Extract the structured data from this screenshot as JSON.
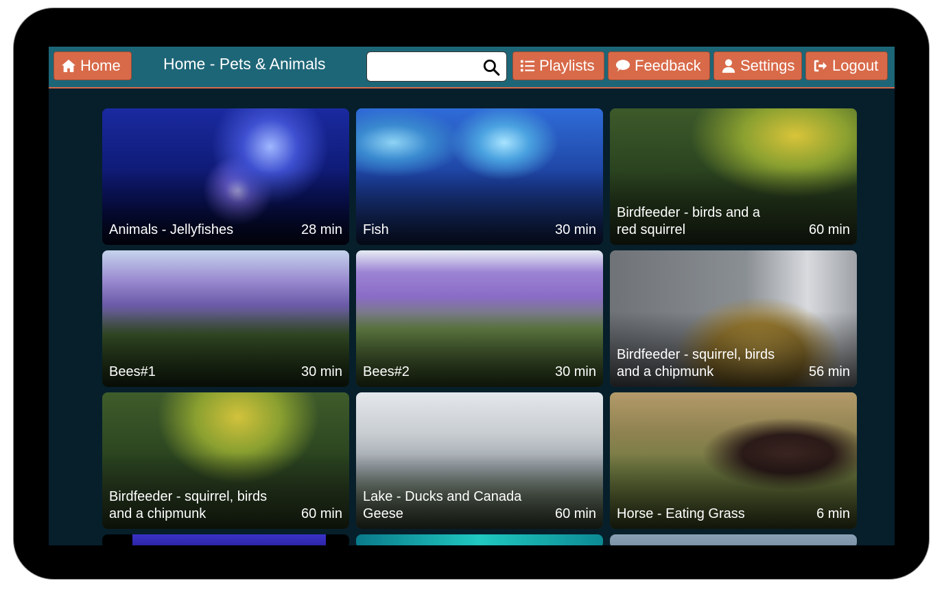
{
  "nav": {
    "home_label": "Home",
    "page_title": "Home - Pets & Animals",
    "search": {
      "value": "",
      "placeholder": ""
    },
    "playlists_label": "Playlists",
    "feedback_label": "Feedback",
    "settings_label": "Settings",
    "logout_label": "Logout"
  },
  "colors": {
    "topbar": "#1d6677",
    "button": "#d86a49",
    "background": "#061f2b"
  },
  "videos": [
    {
      "title": "Animals - Jellyfishes",
      "duration": "28 min",
      "thumbnail": "jellyfish"
    },
    {
      "title": "Fish",
      "duration": "30 min",
      "thumbnail": "aquarium-fish"
    },
    {
      "title": "Birdfeeder - birds and a red squirrel",
      "duration": "60 min",
      "thumbnail": "garden-birdfeeder"
    },
    {
      "title": "Bees#1",
      "duration": "30 min",
      "thumbnail": "lavender-field"
    },
    {
      "title": "Bees#2",
      "duration": "30 min",
      "thumbnail": "lavender-field"
    },
    {
      "title": "Birdfeeder - squirrel, birds and a chipmunk",
      "duration": "56 min",
      "thumbnail": "suet-feeder-tray"
    },
    {
      "title": "Birdfeeder - squirrel, birds and a chipmunk",
      "duration": "60 min",
      "thumbnail": "garden-birdfeeder"
    },
    {
      "title": "Lake - Ducks and Canada Geese",
      "duration": "60 min",
      "thumbnail": "lake-geese"
    },
    {
      "title": "Horse - Eating Grass",
      "duration": "6 min",
      "thumbnail": "horse-pasture"
    }
  ]
}
